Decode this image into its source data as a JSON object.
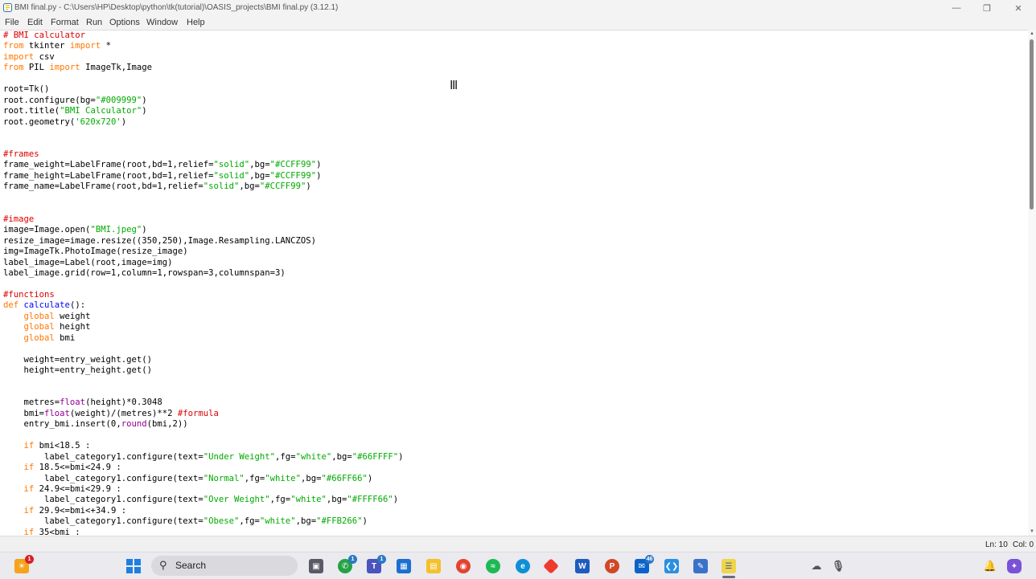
{
  "window": {
    "title": "BMI final.py - C:\\Users\\HP\\Desktop\\python\\tk(tutorial)\\OASIS_projects\\BMI final.py (3.12.1)",
    "controls": [
      "minimize-icon",
      "restore-icon",
      "close-icon"
    ]
  },
  "menu": {
    "items": [
      "File",
      "Edit",
      "Format",
      "Run",
      "Options",
      "Window",
      "Help"
    ]
  },
  "code": {
    "lines": [
      [
        [
          "# BMI calculator",
          "comment"
        ]
      ],
      [
        [
          "from",
          "keyword"
        ],
        [
          " tkinter ",
          ""
        ],
        [
          "import",
          "keyword"
        ],
        [
          " *",
          ""
        ]
      ],
      [
        [
          "import",
          "keyword"
        ],
        [
          " csv",
          ""
        ]
      ],
      [
        [
          "from",
          "keyword"
        ],
        [
          " PIL ",
          ""
        ],
        [
          "import",
          "keyword"
        ],
        [
          " ImageTk,Image",
          ""
        ]
      ],
      [],
      [
        [
          "root=Tk()",
          ""
        ]
      ],
      [
        [
          "root.configure(bg=",
          ""
        ],
        [
          "\"#009999\"",
          "string"
        ],
        [
          ")",
          ""
        ]
      ],
      [
        [
          "root.title(",
          ""
        ],
        [
          "\"BMI Calculator\"",
          "string"
        ],
        [
          ")",
          ""
        ]
      ],
      [
        [
          "root.geometry(",
          ""
        ],
        [
          "'620x720'",
          "string"
        ],
        [
          ")",
          ""
        ]
      ],
      [],
      [],
      [
        [
          "#frames",
          "comment"
        ]
      ],
      [
        [
          "frame_weight=LabelFrame(root,bd=1,relief=",
          ""
        ],
        [
          "\"solid\"",
          "string"
        ],
        [
          ",bg=",
          ""
        ],
        [
          "\"#CCFF99\"",
          "string"
        ],
        [
          ")",
          ""
        ]
      ],
      [
        [
          "frame_height=LabelFrame(root,bd=1,relief=",
          ""
        ],
        [
          "\"solid\"",
          "string"
        ],
        [
          ",bg=",
          ""
        ],
        [
          "\"#CCFF99\"",
          "string"
        ],
        [
          ")",
          ""
        ]
      ],
      [
        [
          "frame_name=LabelFrame(root,bd=1,relief=",
          ""
        ],
        [
          "\"solid\"",
          "string"
        ],
        [
          ",bg=",
          ""
        ],
        [
          "\"#CCFF99\"",
          "string"
        ],
        [
          ")",
          ""
        ]
      ],
      [],
      [],
      [
        [
          "#image",
          "comment"
        ]
      ],
      [
        [
          "image=Image.open(",
          ""
        ],
        [
          "\"BMI.jpeg\"",
          "string"
        ],
        [
          ")",
          ""
        ]
      ],
      [
        [
          "resize_image=image.resize((350,250),Image.Resampling.LANCZOS)",
          ""
        ]
      ],
      [
        [
          "img=ImageTk.PhotoImage(resize_image)",
          ""
        ]
      ],
      [
        [
          "label_image=Label(root,image=img)",
          ""
        ]
      ],
      [
        [
          "label_image.grid(row=1,column=1,rowspan=3,columnspan=3)",
          ""
        ]
      ],
      [],
      [
        [
          "#functions",
          "comment"
        ]
      ],
      [
        [
          "def",
          "keyword"
        ],
        [
          " ",
          ""
        ],
        [
          "calculate",
          "def"
        ],
        [
          "():",
          ""
        ]
      ],
      [
        [
          "    ",
          ""
        ],
        [
          "global",
          "keyword"
        ],
        [
          " weight",
          ""
        ]
      ],
      [
        [
          "    ",
          ""
        ],
        [
          "global",
          "keyword"
        ],
        [
          " height",
          ""
        ]
      ],
      [
        [
          "    ",
          ""
        ],
        [
          "global",
          "keyword"
        ],
        [
          " bmi",
          ""
        ]
      ],
      [],
      [
        [
          "    weight=entry_weight.get()",
          ""
        ]
      ],
      [
        [
          "    height=entry_height.get()",
          ""
        ]
      ],
      [],
      [],
      [
        [
          "    metres=",
          ""
        ],
        [
          "float",
          "builtin"
        ],
        [
          "(height)*0.3048",
          ""
        ]
      ],
      [
        [
          "    bmi=",
          ""
        ],
        [
          "float",
          "builtin"
        ],
        [
          "(weight)/(metres)**2 ",
          ""
        ],
        [
          "#formula",
          "comment"
        ]
      ],
      [
        [
          "    entry_bmi.insert(0,",
          ""
        ],
        [
          "round",
          "builtin"
        ],
        [
          "(bmi,2))",
          ""
        ]
      ],
      [],
      [
        [
          "    ",
          ""
        ],
        [
          "if",
          "keyword"
        ],
        [
          " bmi<18.5 :",
          ""
        ]
      ],
      [
        [
          "        label_category1.configure(text=",
          ""
        ],
        [
          "\"Under Weight\"",
          "string"
        ],
        [
          ",fg=",
          ""
        ],
        [
          "\"white\"",
          "string"
        ],
        [
          ",bg=",
          ""
        ],
        [
          "\"#66FFFF\"",
          "string"
        ],
        [
          ")",
          ""
        ]
      ],
      [
        [
          "    ",
          ""
        ],
        [
          "if",
          "keyword"
        ],
        [
          " 18.5<=bmi<24.9 :",
          ""
        ]
      ],
      [
        [
          "        label_category1.configure(text=",
          ""
        ],
        [
          "\"Normal\"",
          "string"
        ],
        [
          ",fg=",
          ""
        ],
        [
          "\"white\"",
          "string"
        ],
        [
          ",bg=",
          ""
        ],
        [
          "\"#66FF66\"",
          "string"
        ],
        [
          ")",
          ""
        ]
      ],
      [
        [
          "    ",
          ""
        ],
        [
          "if",
          "keyword"
        ],
        [
          " 24.9<=bmi<29.9 :",
          ""
        ]
      ],
      [
        [
          "        label_category1.configure(text=",
          ""
        ],
        [
          "\"Over Weight\"",
          "string"
        ],
        [
          ",fg=",
          ""
        ],
        [
          "\"white\"",
          "string"
        ],
        [
          ",bg=",
          ""
        ],
        [
          "\"#FFFF66\"",
          "string"
        ],
        [
          ")",
          ""
        ]
      ],
      [
        [
          "    ",
          ""
        ],
        [
          "if",
          "keyword"
        ],
        [
          " 29.9<=bmi<+34.9 :",
          ""
        ]
      ],
      [
        [
          "        label_category1.configure(text=",
          ""
        ],
        [
          "\"Obese\"",
          "string"
        ],
        [
          ",fg=",
          ""
        ],
        [
          "\"white\"",
          "string"
        ],
        [
          ",bg=",
          ""
        ],
        [
          "\"#FFB266\"",
          "string"
        ],
        [
          ")",
          ""
        ]
      ],
      [
        [
          "    ",
          ""
        ],
        [
          "if",
          "keyword"
        ],
        [
          " 35<bmi :",
          ""
        ]
      ]
    ]
  },
  "status": {
    "line": "Ln: 10",
    "col": "Col: 0"
  },
  "taskbar": {
    "search_label": "Search",
    "badges": {
      "start_extra": "1",
      "whatsapp": "1",
      "teams": "1",
      "mail": "46"
    },
    "icons": [
      "weather-icon",
      "start-icon",
      "search-icon",
      "task-view-icon",
      "whatsapp-icon",
      "teams-icon",
      "store-icon",
      "file-explorer-icon",
      "chrome-icon",
      "spotify-icon",
      "edge-icon",
      "anydesk-icon",
      "word-icon",
      "powerpoint-icon",
      "mail-icon",
      "vscode-icon",
      "notepad-icon",
      "idle-icon",
      "onedrive-icon",
      "microphone-icon",
      "bell-icon",
      "copilot-icon"
    ]
  },
  "colors": {
    "comment": "#dd0000",
    "keyword": "#ff7700",
    "builtin": "#900090",
    "string": "#00aa00",
    "def": "#0000ff"
  }
}
